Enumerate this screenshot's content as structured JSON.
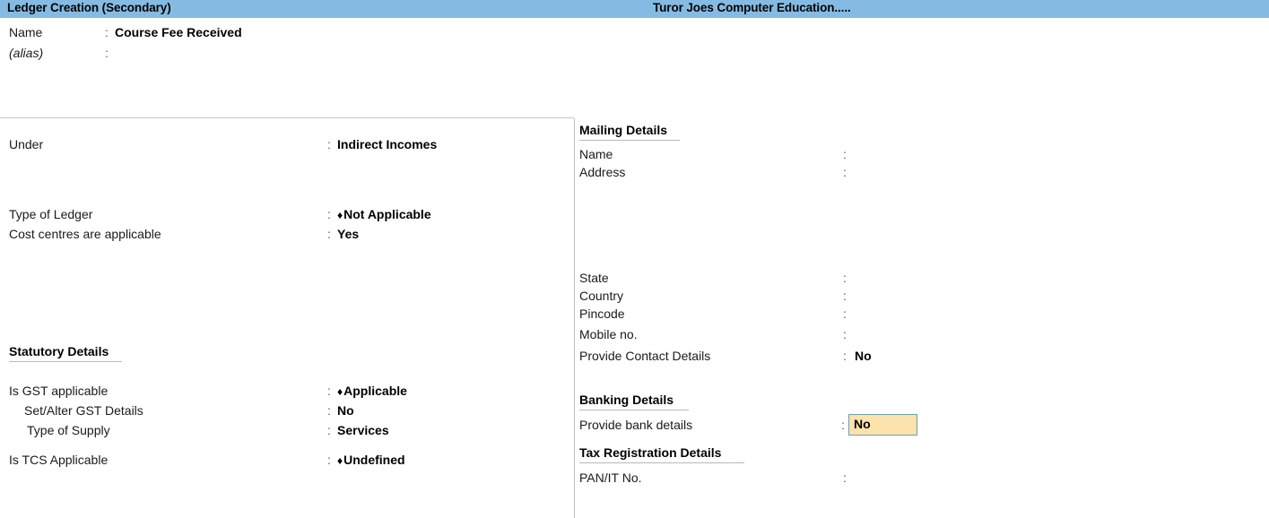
{
  "titlebar": {
    "screen_title": "Ledger Creation (Secondary)",
    "company_name": "Turor Joes Computer Education.....",
    "background_color": "#85bbe3"
  },
  "header_fields": [
    {
      "label": "Name",
      "colon": ":",
      "value": "Course Fee Received"
    },
    {
      "label": "(alias)",
      "colon": ":",
      "value": ""
    }
  ],
  "left_panel": {
    "fields": [
      {
        "label": "Under",
        "colon": ":",
        "value": "Indirect Incomes",
        "marker": ""
      },
      {
        "label": "Type of Ledger",
        "colon": ":",
        "value": "Not Applicable",
        "marker": "♦"
      },
      {
        "label": "Cost centres are applicable",
        "colon": ":",
        "value": "Yes",
        "marker": ""
      }
    ],
    "statutory": {
      "heading": "Statutory Details",
      "fields": [
        {
          "label": "Is GST applicable",
          "colon": ":",
          "value": "Applicable",
          "marker": "♦"
        },
        {
          "label": "Set/Alter GST Details",
          "colon": ":",
          "value": "No",
          "marker": ""
        },
        {
          "label": "Type of Supply",
          "colon": ":",
          "value": "Services",
          "marker": ""
        },
        {
          "label": "Is TCS Applicable",
          "colon": ":",
          "value": "Undefined",
          "marker": "♦"
        }
      ]
    }
  },
  "right_panel": {
    "mailing": {
      "heading": "Mailing Details",
      "fields": [
        {
          "label": "Name",
          "colon": ":",
          "value": ""
        },
        {
          "label": "Address",
          "colon": ":",
          "value": ""
        },
        {
          "label": "State",
          "colon": ":",
          "value": ""
        },
        {
          "label": "Country",
          "colon": ":",
          "value": ""
        },
        {
          "label": "Pincode",
          "colon": ":",
          "value": ""
        },
        {
          "label": "Mobile no.",
          "colon": ":",
          "value": ""
        },
        {
          "label": "Provide Contact Details",
          "colon": ":",
          "value": "No"
        }
      ]
    },
    "banking": {
      "heading": "Banking Details",
      "field": {
        "label": "Provide bank details",
        "colon": ":",
        "value": "No",
        "focused": true,
        "background_color": "#fce2ad",
        "border_color": "#6e9fae"
      }
    },
    "tax": {
      "heading": "Tax Registration Details",
      "fields": [
        {
          "label": "PAN/IT No.",
          "colon": ":",
          "value": ""
        }
      ]
    }
  }
}
